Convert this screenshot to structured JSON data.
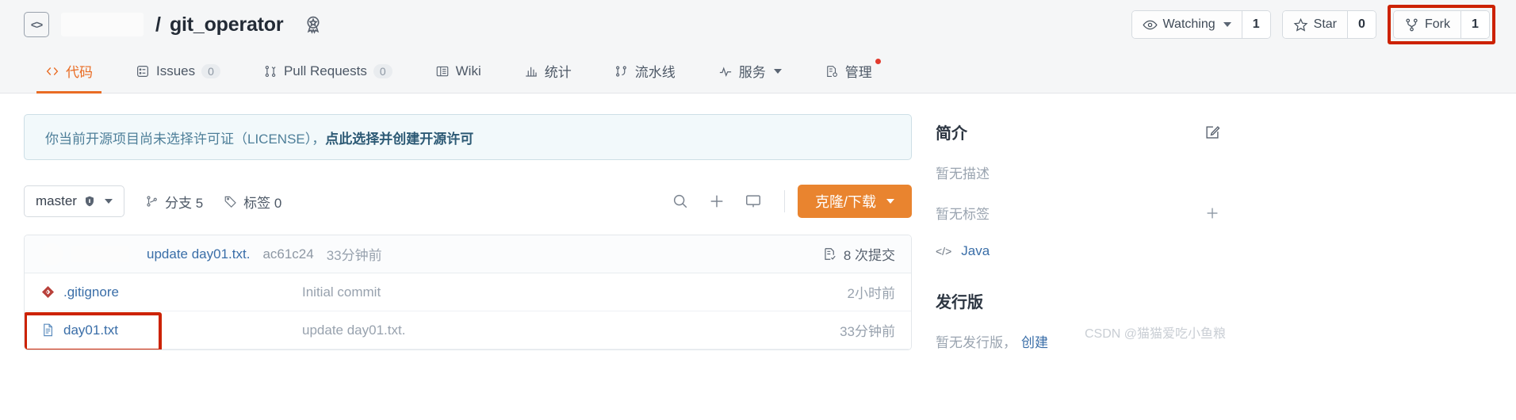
{
  "header": {
    "owner_redacted": true,
    "separator": "/",
    "repo_name": "git_operator",
    "badge_icon": "award-badge-icon",
    "code_icon": "code-brackets-icon",
    "actions": [
      {
        "icon": "eye-icon",
        "label": "Watching",
        "has_caret": true,
        "count": "1",
        "highlighted": false
      },
      {
        "icon": "star-icon",
        "label": "Star",
        "has_caret": false,
        "count": "0",
        "highlighted": false
      },
      {
        "icon": "fork-icon",
        "label": "Fork",
        "has_caret": false,
        "count": "1",
        "highlighted": true
      }
    ]
  },
  "tabs": [
    {
      "icon": "code-icon",
      "label": "代码",
      "count": null,
      "active": true,
      "caret": false,
      "dot": false
    },
    {
      "icon": "issues-icon",
      "label": "Issues",
      "count": "0",
      "active": false,
      "caret": false,
      "dot": false
    },
    {
      "icon": "pull-request-icon",
      "label": "Pull Requests",
      "count": "0",
      "active": false,
      "caret": false,
      "dot": false
    },
    {
      "icon": "wiki-book-icon",
      "label": "Wiki",
      "count": null,
      "active": false,
      "caret": false,
      "dot": false
    },
    {
      "icon": "chart-icon",
      "label": "统计",
      "count": null,
      "active": false,
      "caret": false,
      "dot": false
    },
    {
      "icon": "pipeline-icon",
      "label": "流水线",
      "count": null,
      "active": false,
      "caret": false,
      "dot": false
    },
    {
      "icon": "activity-icon",
      "label": "服务",
      "count": null,
      "active": false,
      "caret": true,
      "dot": false
    },
    {
      "icon": "settings-doc-icon",
      "label": "管理",
      "count": null,
      "active": false,
      "caret": false,
      "dot": true
    }
  ],
  "banner": {
    "text": "你当前开源项目尚未选择许可证（LICENSE），",
    "link_text": "点此选择并创建开源许可"
  },
  "toolbar": {
    "branch_name": "master",
    "branch_shield_icon": "shield-icon",
    "branch_caret_icon": "chevron-down-icon",
    "branches_label": "分支 5",
    "branches_icon": "branch-icon",
    "tags_label": "标签 0",
    "tags_icon": "tag-icon",
    "search_icon": "search-icon",
    "add_icon": "plus-icon",
    "ide_icon": "monitor-icon",
    "clone_label": "克隆/下载",
    "clone_caret_icon": "chevron-down-icon",
    "clone_color": "#e9842f"
  },
  "commit_bar": {
    "author_redacted": true,
    "message": "update day01.txt.",
    "sha": "ac61c24",
    "time": "33分钟前",
    "commits_icon": "commit-history-icon",
    "commits_label": "8 次提交"
  },
  "files": [
    {
      "icon": "git-file-icon",
      "name": ".gitignore",
      "commit_message": "Initial commit",
      "time": "2小时前",
      "highlighted": false
    },
    {
      "icon": "text-file-icon",
      "name": "day01.txt",
      "commit_message": "update day01.txt.",
      "time": "33分钟前",
      "highlighted": true
    }
  ],
  "sidebar": {
    "about_title": "简介",
    "about_edit_icon": "edit-pencil-icon",
    "no_description": "暂无描述",
    "no_tags": "暂无标签",
    "add_tag_icon": "plus-icon",
    "language_icon": "code-brackets-icon",
    "language": "Java",
    "releases_title": "发行版",
    "no_releases": "暂无发行版，",
    "create_release": "创建"
  },
  "watermark": "CSDN @猫猫爱吃小鱼粮",
  "colors": {
    "accent_orange": "#e96c24",
    "link_blue": "#3a6ea8",
    "highlight_red": "#cc2200",
    "banner_bg": "#f2f9fb"
  }
}
